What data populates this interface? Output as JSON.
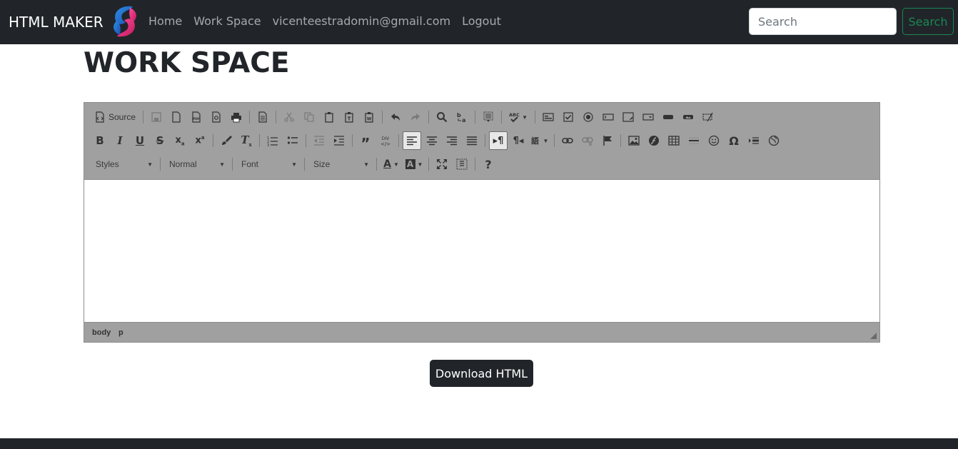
{
  "navbar": {
    "brand": "HTML MAKER",
    "links": [
      "Home",
      "Work Space",
      "vicenteestradomin@gmail.com",
      "Logout"
    ],
    "search_placeholder": "Search",
    "search_button": "Search"
  },
  "page": {
    "title": "WORK SPACE"
  },
  "editor": {
    "source_label": "Source",
    "combos": {
      "styles": "Styles",
      "format": "Normal",
      "font": "Font",
      "size": "Size"
    },
    "path": [
      "body",
      "p"
    ],
    "content": ""
  },
  "download_button": "Download HTML",
  "colors": {
    "navbar": "#212529",
    "accent_green": "#198754",
    "toolbar": "#a0a0a0"
  }
}
